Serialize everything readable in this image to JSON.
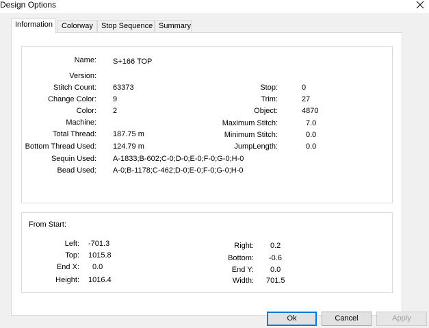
{
  "window": {
    "title": "Design Options"
  },
  "tabs": [
    {
      "label": "Information"
    },
    {
      "label": "Colorway"
    },
    {
      "label": "Stop Sequence"
    },
    {
      "label": "Summary"
    }
  ],
  "info": {
    "name": {
      "label": "Name:",
      "value": "S+166 TOP"
    },
    "version": {
      "label": "Version:",
      "value": ""
    },
    "stitch_count": {
      "label": "Stitch Count:",
      "value": "63373"
    },
    "change_color": {
      "label": "Change Color:",
      "value": "9"
    },
    "color": {
      "label": "Color:",
      "value": "2"
    },
    "machine": {
      "label": "Machine:",
      "value": ""
    },
    "total_thread": {
      "label": "Total Thread:",
      "value": "187.75 m"
    },
    "bottom_thread_used": {
      "label": "Bottom Thread Used:",
      "value": "124.79 m"
    },
    "sequin_used": {
      "label": "Sequin Used:",
      "value": "A-1833;B-602;C-0;D-0;E-0;F-0;G-0;H-0"
    },
    "bead_used": {
      "label": "Bead Used:",
      "value": "A-0;B-1178;C-462;D-0;E-0;F-0;G-0;H-0"
    },
    "stop": {
      "label": "Stop:",
      "value": "0"
    },
    "trim": {
      "label": "Trim:",
      "value": "27"
    },
    "object": {
      "label": "Object:",
      "value": "4870"
    },
    "maximum_stitch": {
      "label": "Maximum Stitch:",
      "value": "7.0"
    },
    "minimum_stitch": {
      "label": "Minimum Stitch:",
      "value": "0.0"
    },
    "jump_length": {
      "label": "JumpLength:",
      "value": "0.0"
    }
  },
  "from_start": {
    "title": "From Start:",
    "left": {
      "label": "Left:",
      "value": "-701.3"
    },
    "top": {
      "label": "Top:",
      "value": "1015.8"
    },
    "end_x": {
      "label": "End X:",
      "value": "0.0"
    },
    "height": {
      "label": "Height:",
      "value": "1016.4"
    },
    "right": {
      "label": "Right:",
      "value": "0.2"
    },
    "bottom": {
      "label": "Bottom:",
      "value": "-0.6"
    },
    "end_y": {
      "label": "End Y:",
      "value": "0.0"
    },
    "width": {
      "label": "Width:",
      "value": "701.5"
    }
  },
  "buttons": {
    "ok": "Ok",
    "cancel": "Cancel",
    "apply": "Apply"
  }
}
